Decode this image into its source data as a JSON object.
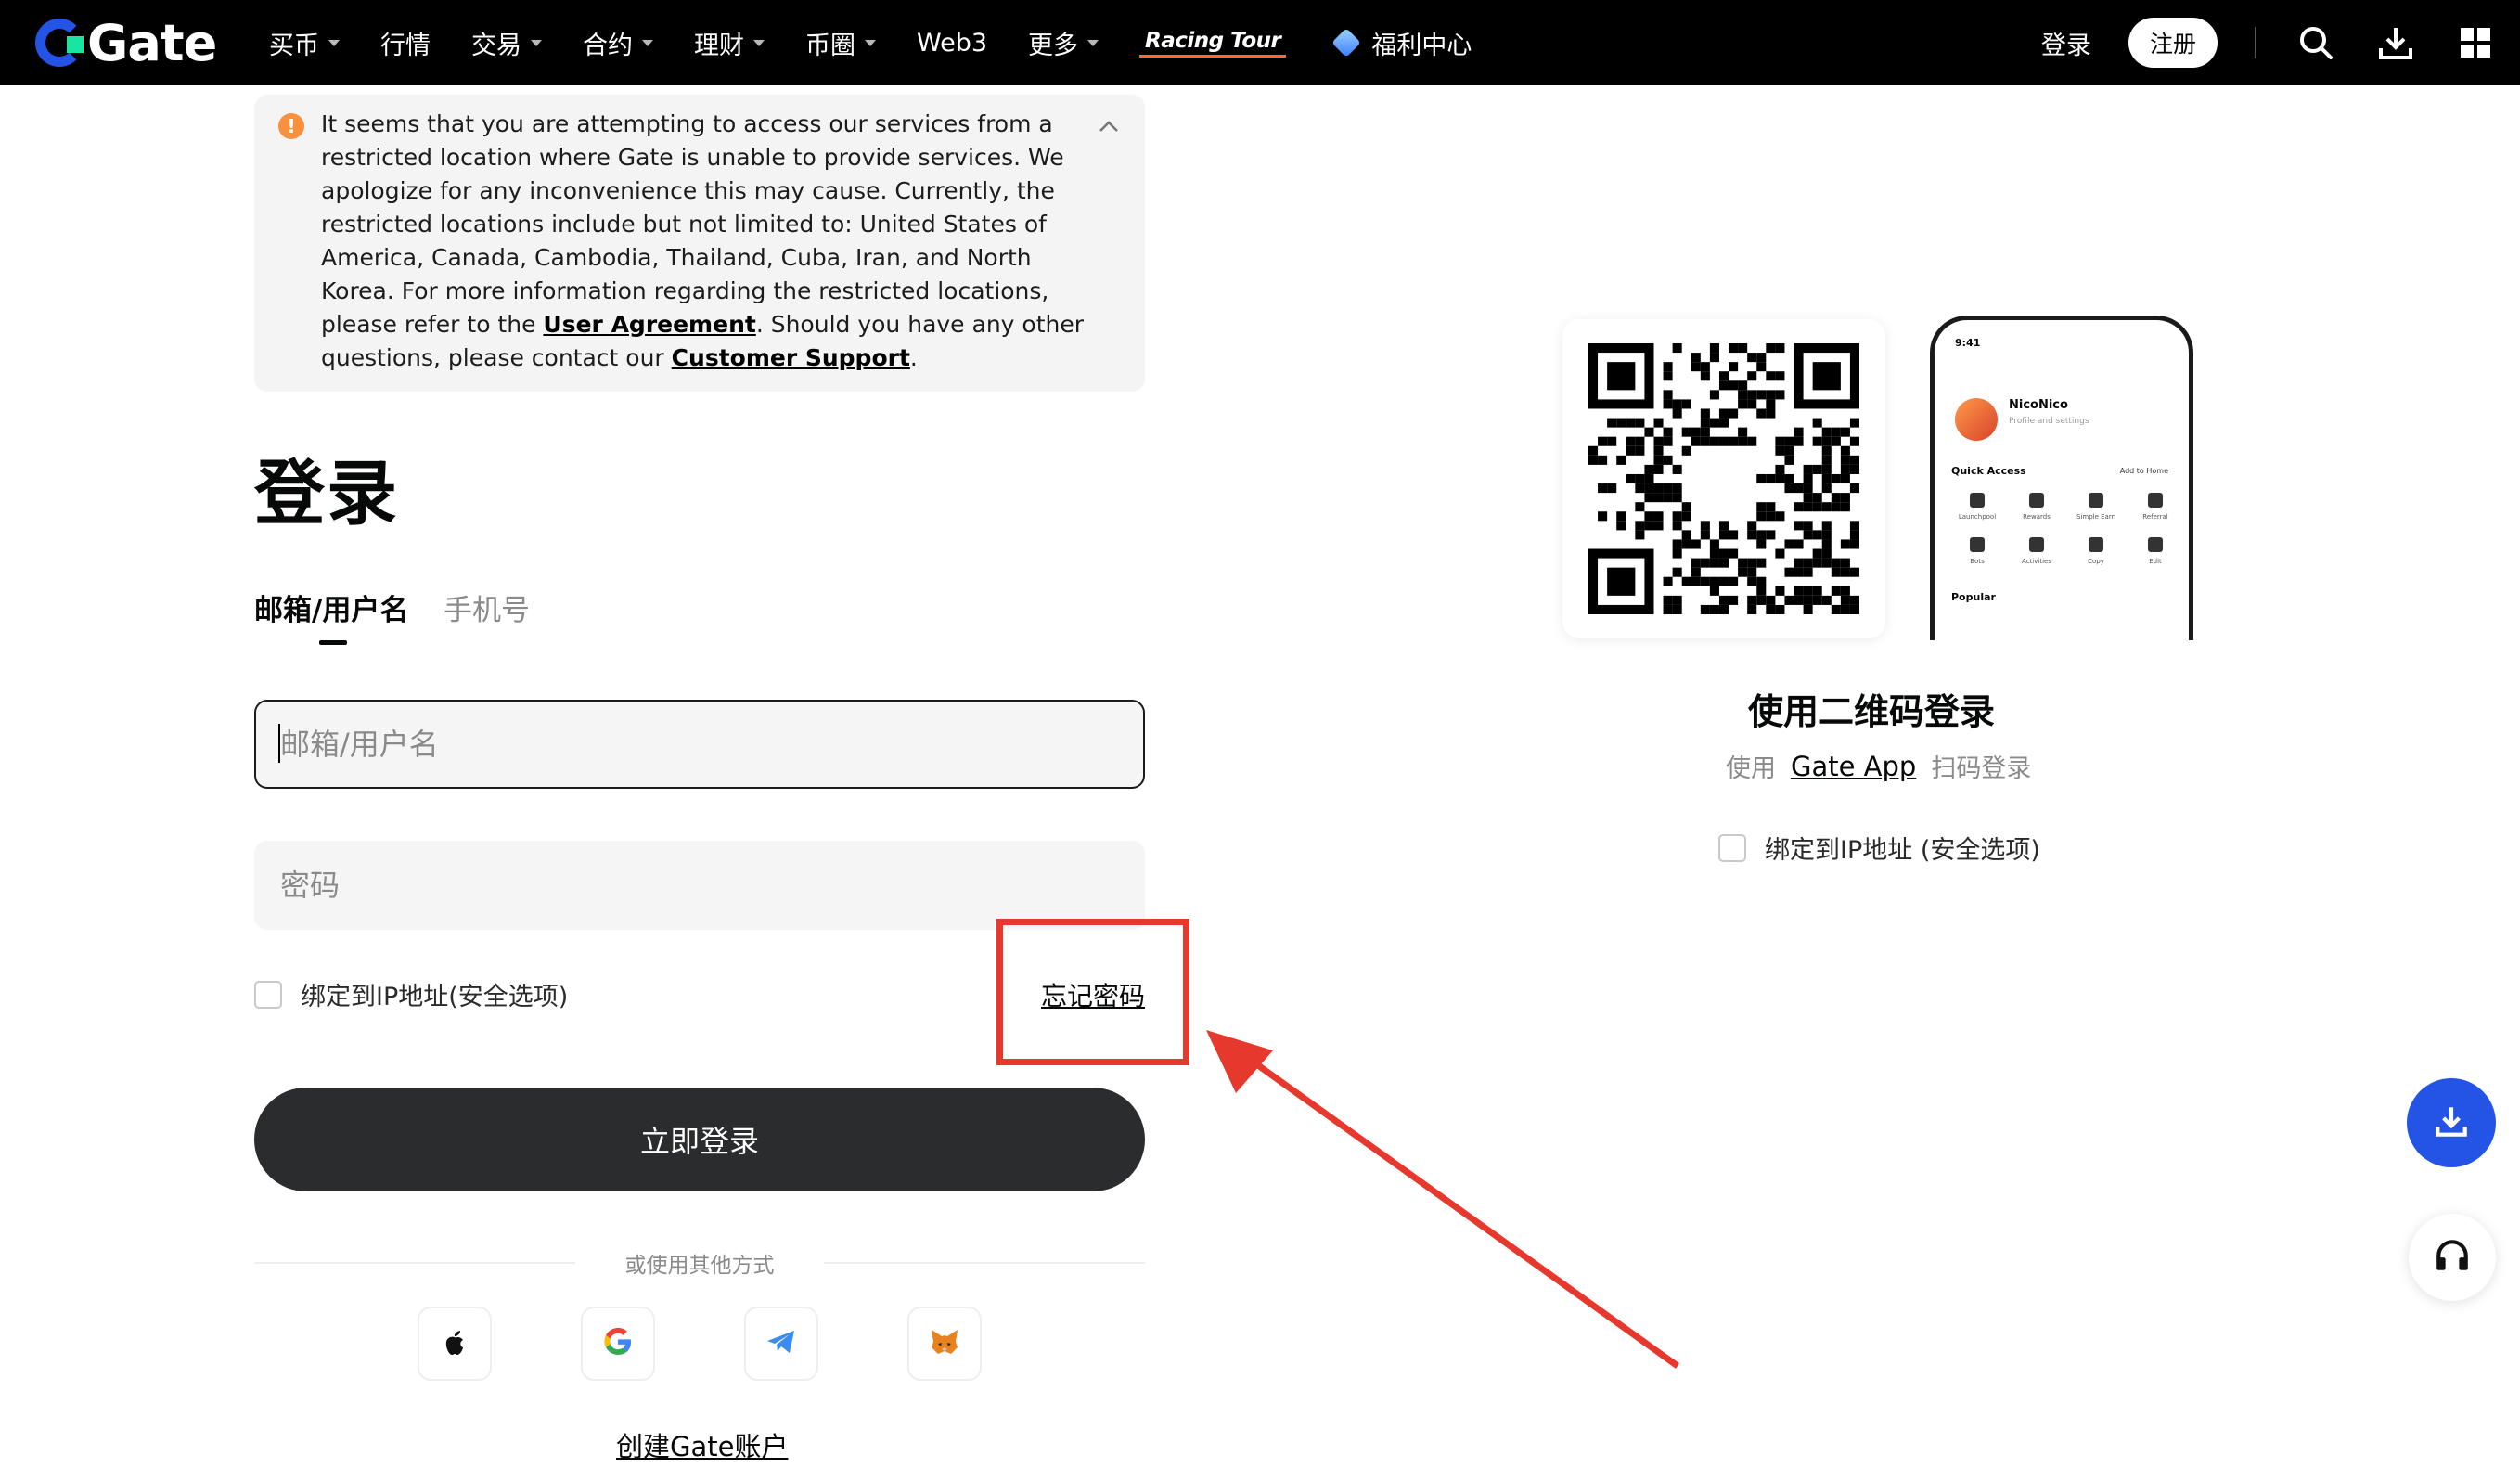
{
  "header": {
    "logo_text": "Gate",
    "nav": [
      {
        "label": "买币",
        "caret": true
      },
      {
        "label": "行情",
        "caret": false
      },
      {
        "label": "交易",
        "caret": true
      },
      {
        "label": "合约",
        "caret": true
      },
      {
        "label": "理财",
        "caret": true
      },
      {
        "label": "币圈",
        "caret": true
      },
      {
        "label": "Web3",
        "caret": false
      },
      {
        "label": "更多",
        "caret": true
      }
    ],
    "racing_label": "Racing Tour",
    "welfare_label": "福利中心",
    "login_label": "登录",
    "register_label": "注册",
    "icons": [
      "search-icon",
      "download-icon",
      "apps-grid-icon"
    ]
  },
  "notice": {
    "icon": "warning-icon",
    "text_1": "It seems that you are attempting to access our services from a restricted location where Gate is unable to provide services. We apologize for any inconvenience this may cause. Currently, the restricted locations include but not limited to: United States of America, Canada, Cambodia, Thailand, Cuba, Iran, and North Korea. For more information regarding the restricted locations, please refer to the ",
    "link_agreement": "User Agreement",
    "text_2": ". Should you have any other questions, please contact our ",
    "link_support": "Customer Support",
    "text_3": "."
  },
  "login": {
    "title": "登录",
    "tabs": [
      "邮箱/用户名",
      "手机号"
    ],
    "email_placeholder": "邮箱/用户名",
    "password_placeholder": "密码",
    "bind_ip_label": "绑定到IP地址(安全选项)",
    "forgot_label": "忘记密码",
    "submit_label": "立即登录",
    "or_label": "或使用其他方式",
    "social": [
      "apple-icon",
      "google-icon",
      "telegram-icon",
      "metamask-icon"
    ],
    "create_label": "创建Gate账户"
  },
  "qr": {
    "title": "使用二维码登录",
    "sub_prefix": "使用",
    "sub_app": "Gate App",
    "sub_suffix": "扫码登录",
    "bind_ip_label": "绑定到IP地址 (安全选项)"
  },
  "phone": {
    "time": "9:41",
    "name": "NicoNico",
    "sub": "Profile and settings",
    "quick_access": "Quick Access",
    "add_to_home": "Add to Home",
    "row1": [
      "Launchpool",
      "Rewards",
      "Simple Earn",
      "Referral"
    ],
    "row2": [
      "Bots",
      "Activities",
      "Copy",
      "Edit"
    ],
    "popular": "Popular"
  },
  "colors": {
    "brand_blue": "#2354e6",
    "brand_green": "#17e5a1",
    "annotation_red": "#e6382d",
    "button_dark": "#2b2c2e"
  }
}
